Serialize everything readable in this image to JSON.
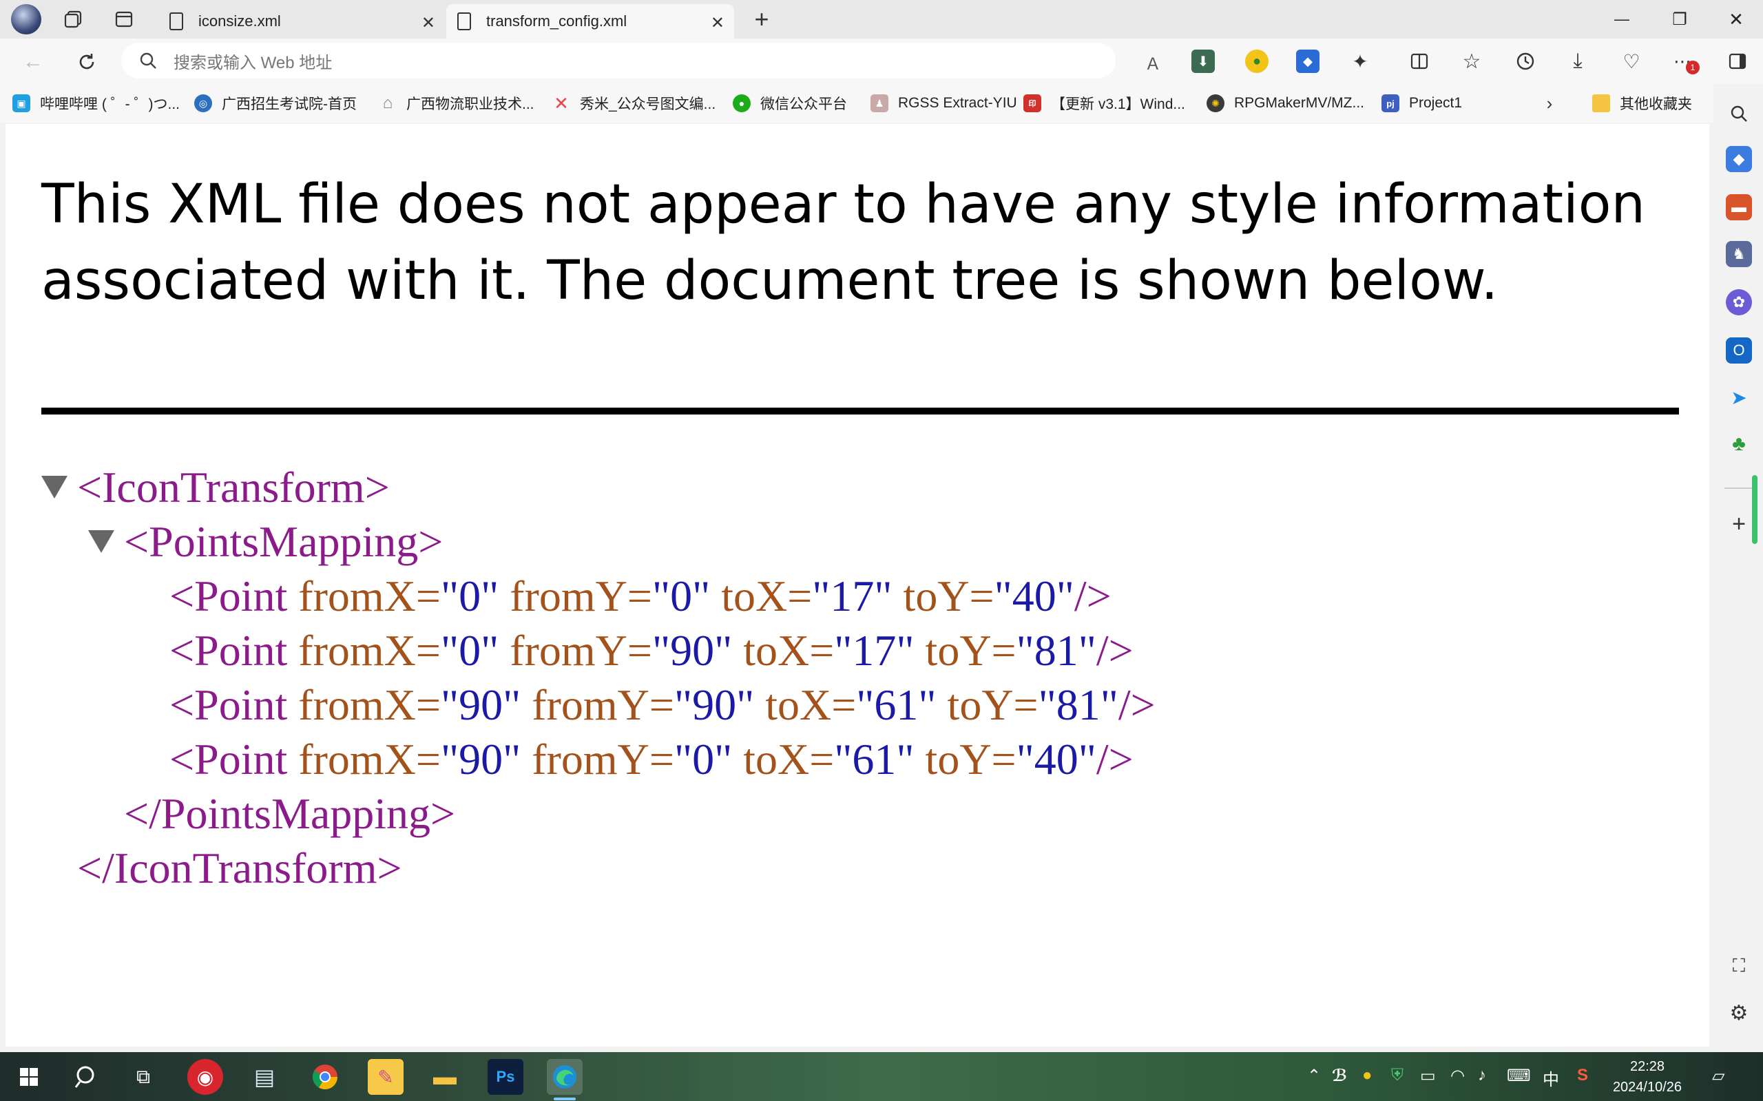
{
  "tabs": [
    {
      "title": "iconsize.xml",
      "active": false
    },
    {
      "title": "transform_config.xml",
      "active": true
    }
  ],
  "window": {
    "minimize": "—",
    "restore": "❐",
    "close": "✕"
  },
  "address": {
    "placeholder": "搜索或输入 Web 地址"
  },
  "favorites": [
    {
      "label": "哔哩哔哩 ( ゜- ゜)つ...",
      "icon": "bilibili-icon",
      "color": "#1ea0e1"
    },
    {
      "label": "广西招生考试院-首页",
      "icon": "site-icon",
      "color": "#2c6fbf"
    },
    {
      "label": "广西物流职业技术...",
      "icon": "home-icon",
      "color": "#888888"
    },
    {
      "label": "秀米_公众号图文编...",
      "icon": "xiumi-icon",
      "color": "#e8464b"
    },
    {
      "label": "微信公众平台",
      "icon": "wechat-icon",
      "color": "#1aad19"
    },
    {
      "label": "RGSS Extract-YIU",
      "icon": "rgss-icon",
      "color": "#9a6c6c"
    },
    {
      "label": "【更新 v3.1】Wind...",
      "icon": "seal-icon",
      "color": "#d0312d"
    },
    {
      "label": "RPGMakerMV/MZ...",
      "icon": "rpgmaker-icon",
      "color": "#3a3a3a"
    },
    {
      "label": "Project1",
      "icon": "project1-icon",
      "color": "#3c5fc0"
    }
  ],
  "favorites_more": "其他收藏夹",
  "page": {
    "headline": "This XML file does not appear to have any style information associated with it. The document tree is shown below.",
    "xml": {
      "root_open": "<IconTransform>",
      "mapping_open": "<PointsMapping>",
      "points": [
        {
          "fromX": "0",
          "fromY": "0",
          "toX": "17",
          "toY": "40"
        },
        {
          "fromX": "0",
          "fromY": "90",
          "toX": "17",
          "toY": "81"
        },
        {
          "fromX": "90",
          "fromY": "90",
          "toX": "61",
          "toY": "81"
        },
        {
          "fromX": "90",
          "fromY": "0",
          "toX": "61",
          "toY": "40"
        }
      ],
      "point_tag": "<Point",
      "tag_end": "/>",
      "attr_names": {
        "fromX": "fromX=",
        "fromY": "fromY=",
        "toX": "toX=",
        "toY": "toY="
      },
      "mapping_close": "</PointsMapping>",
      "root_close": "</IconTransform>"
    }
  },
  "taskbar": {
    "time": "22:28",
    "date": "2024/10/26",
    "ime": "中"
  }
}
